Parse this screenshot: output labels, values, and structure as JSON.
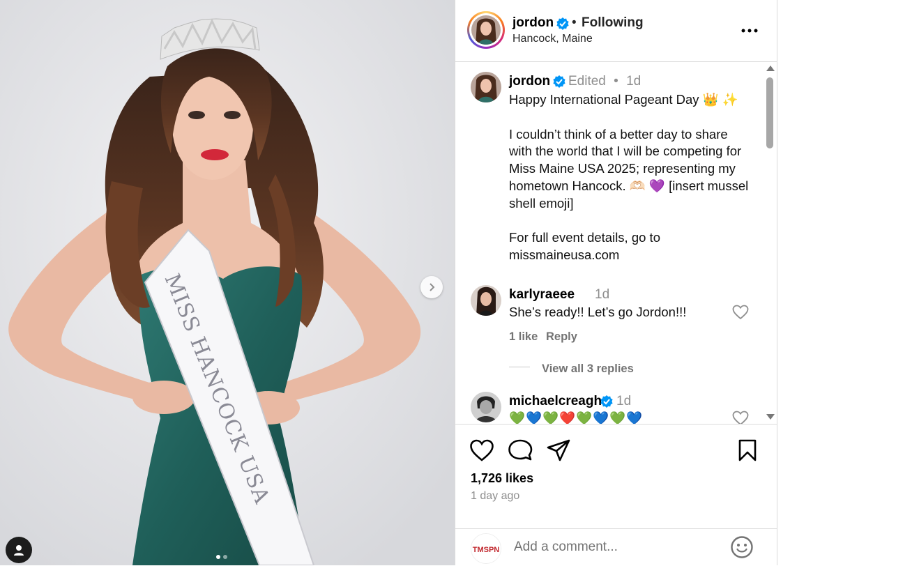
{
  "post": {
    "username": "jordon",
    "following_label": "Following",
    "separator": "•",
    "location": "Hancock, Maine"
  },
  "photo": {
    "sash_text": "MISS HANCOCK USA",
    "slide_count": 2,
    "current_slide": 1
  },
  "caption": {
    "username": "jordon",
    "edited_label": "Edited",
    "separator": "•",
    "time": "1d",
    "text": "Happy International Pageant Day 👑 ✨\n\nI couldn’t think of a better day to share with the world that I will be competing for Miss Maine USA 2025; representing my hometown Hancock. 🫶🏻 💜 [insert mussel shell emoji]\n\nFor full event details, go to missmaineusa.com"
  },
  "comments": [
    {
      "username": "karlyraeee",
      "time": "1d",
      "text": "She’s ready!! Let’s go Jordon!!!",
      "likes_label": "1 like",
      "reply_label": "Reply",
      "view_replies_label": "View all 3 replies"
    },
    {
      "username": "michaelcreagh",
      "time": "1d",
      "text": "💚💙💚❤️💚💙💚💙"
    }
  ],
  "stats": {
    "likes_label": "1,726 likes",
    "time_ago": "1 day ago"
  },
  "add_comment": {
    "placeholder": "Add a comment...",
    "avatar_text": "TMSPN"
  },
  "colors": {
    "verified": "#0095f6",
    "secondary_text": "#8e8e8e",
    "border": "#dbdbdb"
  }
}
